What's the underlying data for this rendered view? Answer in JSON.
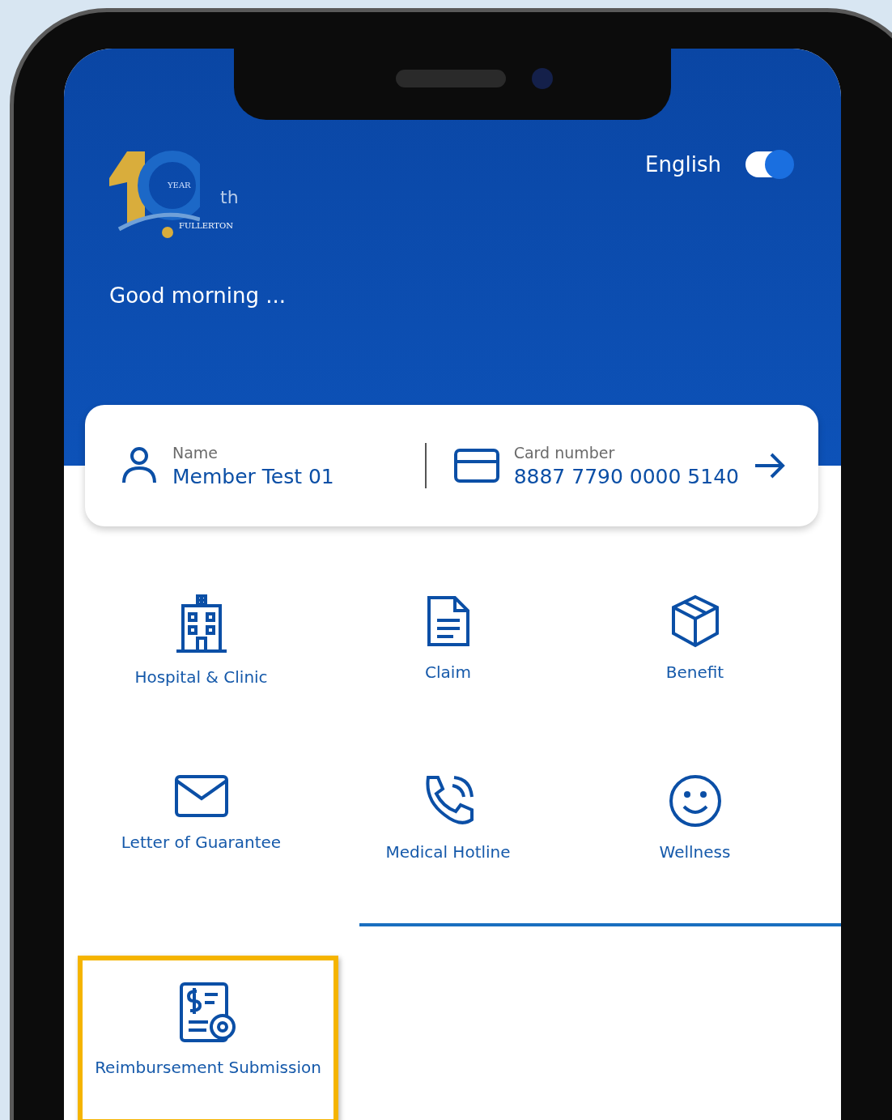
{
  "logo": {
    "year": "YEAR",
    "suffix": "th",
    "brand": "FULLERTON"
  },
  "language": {
    "label": "English",
    "on": true
  },
  "greeting": "Good morning ...",
  "member_card": {
    "name_label": "Name",
    "name": "Member Test 01",
    "card_label": "Card number",
    "card_number": "8887 7790 0000 5140"
  },
  "menu": [
    {
      "kind": "hospital",
      "label": "Hospital & Clinic",
      "highlighted": false
    },
    {
      "kind": "claim",
      "label": "Claim",
      "highlighted": false
    },
    {
      "kind": "benefit",
      "label": "Benefit",
      "highlighted": false
    },
    {
      "kind": "letter",
      "label": "Letter of Guarantee",
      "highlighted": false
    },
    {
      "kind": "hotline",
      "label": "Medical Hotline",
      "highlighted": false
    },
    {
      "kind": "wellness",
      "label": "Wellness",
      "highlighted": false
    },
    {
      "kind": "reimbursement",
      "label": "Reimbursement Submission",
      "highlighted": true
    }
  ]
}
